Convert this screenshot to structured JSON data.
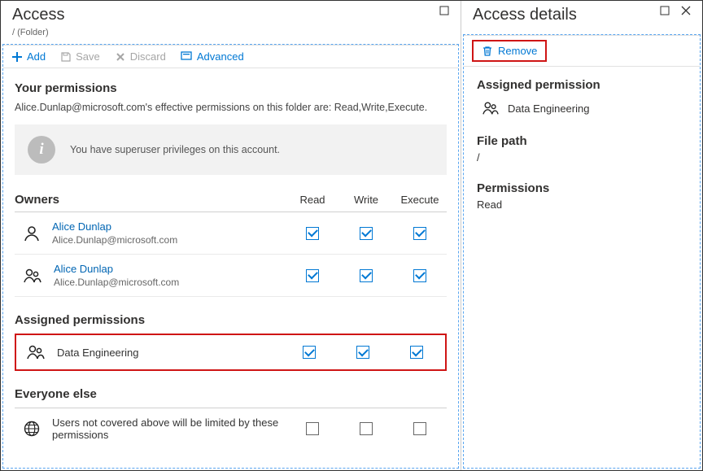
{
  "left": {
    "title": "Access",
    "subtitle": "/ (Folder)",
    "toolbar": {
      "add": "Add",
      "save": "Save",
      "discard": "Discard",
      "advanced": "Advanced"
    },
    "your_permissions": {
      "title": "Your permissions",
      "desc": "Alice.Dunlap@microsoft.com's effective permissions on this folder are: Read,Write,Execute.",
      "banner": "You have superuser privileges on this account."
    },
    "columns": {
      "owners": "Owners",
      "read": "Read",
      "write": "Write",
      "execute": "Execute"
    },
    "owners": [
      {
        "name": "Alice Dunlap",
        "email": "Alice.Dunlap@microsoft.com",
        "read": true,
        "write": true,
        "execute": true,
        "type": "single"
      },
      {
        "name": "Alice Dunlap",
        "email": "Alice.Dunlap@microsoft.com",
        "read": true,
        "write": true,
        "execute": true,
        "type": "group"
      }
    ],
    "assigned_title": "Assigned permissions",
    "assigned": [
      {
        "name": "Data Engineering",
        "read": true,
        "write": true,
        "execute": true
      }
    ],
    "everyone_title": "Everyone else",
    "everyone": {
      "text": "Users not covered above will be limited by these permissions",
      "read": false,
      "write": false,
      "execute": false
    }
  },
  "right": {
    "title": "Access details",
    "remove": "Remove",
    "assigned_title": "Assigned permission",
    "assigned_name": "Data Engineering",
    "filepath_label": "File path",
    "filepath": "/",
    "perm_label": "Permissions",
    "perm": "Read"
  }
}
